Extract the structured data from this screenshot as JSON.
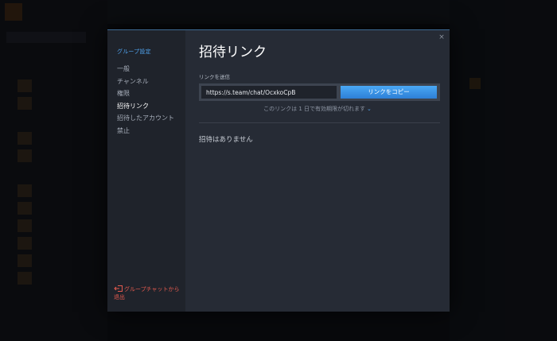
{
  "modal": {
    "sidebar": {
      "title": "グループ設定",
      "items": [
        {
          "label": "一般",
          "active": false
        },
        {
          "label": "チャンネル",
          "active": false
        },
        {
          "label": "権限",
          "active": false
        },
        {
          "label": "招待リンク",
          "active": true
        },
        {
          "label": "招待したアカウント",
          "active": false
        },
        {
          "label": "禁止",
          "active": false
        }
      ],
      "leave_label": "グループチャットから退出"
    },
    "close_label": "×",
    "title": "招待リンク",
    "send_link_label": "リンクを送信",
    "invite_url": "https://s.team/chat/OcxkoCpB",
    "copy_button_label": "リンクをコピー",
    "expiry_text": "このリンクは 1 日で有効期限が切れます",
    "expiry_chevron": "⌄",
    "empty_text": "招待はありません"
  },
  "colors": {
    "accent": "#4fa3ee",
    "danger": "#e35a4e",
    "modal_bg": "#262b35",
    "sidebar_bg": "#1f232b"
  }
}
